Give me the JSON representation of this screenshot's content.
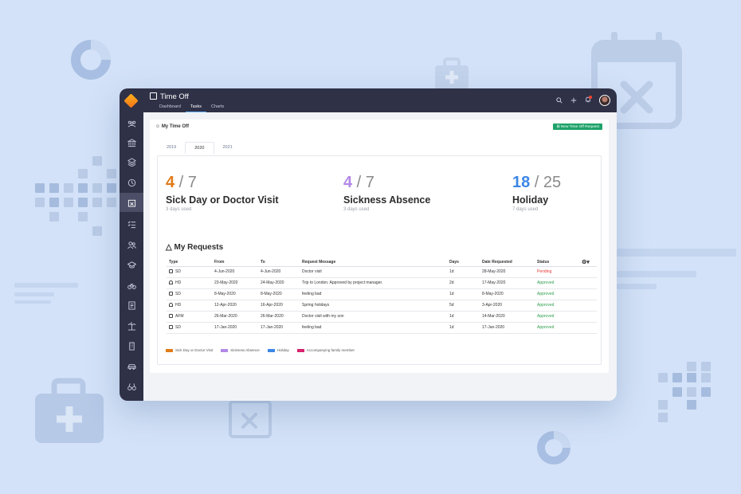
{
  "app": {
    "title": "Time Off",
    "tabs": [
      {
        "label": "Dashboard"
      },
      {
        "label": "Tasks"
      },
      {
        "label": "Charts"
      }
    ],
    "accent": "#5fb0ff"
  },
  "panel": {
    "title": "My Time Off",
    "new_button": "New Time Off Request",
    "years": [
      "2019",
      "2020",
      "2021"
    ],
    "selected_year": "2020"
  },
  "stats": [
    {
      "used": "4",
      "total": "7",
      "label": "Sick Day or Doctor Visit",
      "sub": "3 days used",
      "color": "#e07b1a"
    },
    {
      "used": "4",
      "total": "7",
      "label": "Sickness Absence",
      "sub": "3 days used",
      "color": "#b389e6"
    },
    {
      "used": "18",
      "total": "25",
      "label": "Holiday",
      "sub": "7 days used",
      "color": "#3d86e6"
    }
  ],
  "requests": {
    "title": "My Requests",
    "columns": [
      "Type",
      "From",
      "To",
      "Request Message",
      "Days",
      "Date Requested",
      "Status"
    ],
    "rows": [
      {
        "type": "SD",
        "from": "4-Jun-2020",
        "to": "4-Jun-2020",
        "message": "Doctor visit",
        "days": "1d",
        "requested": "28-May-2020",
        "status": "Pending"
      },
      {
        "type": "HD",
        "from": "23-May-2020",
        "to": "24-May-2020",
        "message": "Trip to London. Approved by project manager.",
        "days": "2d",
        "requested": "17-May-2020",
        "status": "Approved"
      },
      {
        "type": "SD",
        "from": "8-May-2020",
        "to": "8-May-2020",
        "message": "feeling bad",
        "days": "1d",
        "requested": "8-May-2020",
        "status": "Approved"
      },
      {
        "type": "HD",
        "from": "12-Apr-2020",
        "to": "16-Apr-2020",
        "message": "Spring holidays",
        "days": "5d",
        "requested": "3-Apr-2020",
        "status": "Approved"
      },
      {
        "type": "AFM",
        "from": "26-Mar-2020",
        "to": "26-Mar-2020",
        "message": "Doctor visit with my son",
        "days": "1d",
        "requested": "14-Mar-2020",
        "status": "Approved"
      },
      {
        "type": "SD",
        "from": "17-Jan-2020",
        "to": "17-Jan-2020",
        "message": "feeling bad",
        "days": "1d",
        "requested": "17-Jan-2020",
        "status": "Approved"
      }
    ]
  },
  "legend": [
    {
      "label": "Sick Day or Doctor Visit",
      "color": "#e07b1a"
    },
    {
      "label": "Sickness Absence",
      "color": "#b389e6"
    },
    {
      "label": "Holiday",
      "color": "#3d86e6"
    },
    {
      "label": "Accompanying family member",
      "color": "#d6246e"
    }
  ]
}
